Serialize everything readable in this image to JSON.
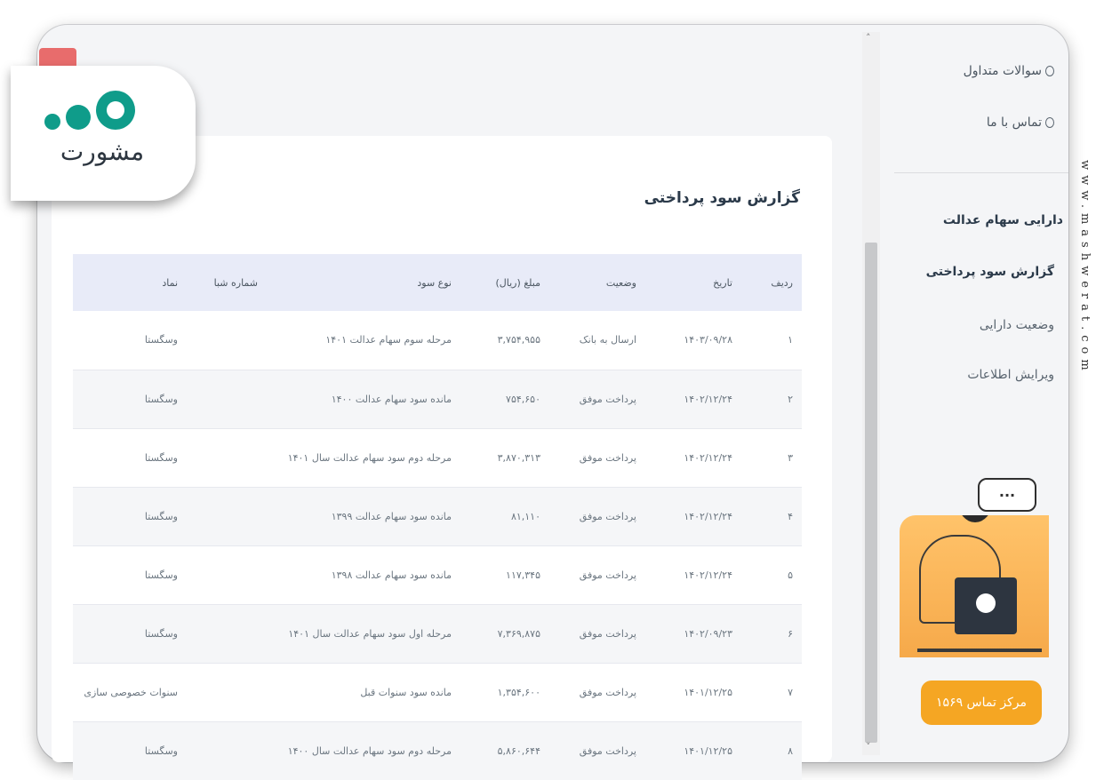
{
  "logo": {
    "word": "مشورت"
  },
  "sidebar": {
    "links": [
      {
        "label": "سوالات متداول",
        "icon": "question-icon"
      },
      {
        "label": "تماس با ما",
        "icon": "phone-icon"
      }
    ],
    "section_title": "دارایی سهام عدالت",
    "items": [
      {
        "label": "گزارش سود پرداختی",
        "active": true
      },
      {
        "label": "وضعیت دارایی",
        "active": false
      },
      {
        "label": "ویرایش اطلاعات",
        "active": false
      }
    ],
    "bubble": "...",
    "call_center": "مرکز تماس ۱۵۶۹"
  },
  "report": {
    "title": "گزارش سود پرداختی",
    "columns": [
      "ردیف",
      "تاریخ",
      "وضعیت",
      "مبلغ (ریال)",
      "نوع سود",
      "شماره شبا",
      "نماد"
    ],
    "rows": [
      [
        "۱",
        "۱۴۰۳/۰۹/۲۸",
        "ارسال به بانک",
        "۳,۷۵۴,۹۵۵",
        "مرحله سوم سهام عدالت ۱۴۰۱",
        "",
        "وسگستا"
      ],
      [
        "۲",
        "۱۴۰۲/۱۲/۲۴",
        "پرداخت موفق",
        "۷۵۴,۶۵۰",
        "مانده سود سهام عدالت ۱۴۰۰",
        "",
        "وسگستا"
      ],
      [
        "۳",
        "۱۴۰۲/۱۲/۲۴",
        "پرداخت موفق",
        "۳,۸۷۰,۳۱۳",
        "مرحله دوم سود سهام عدالت سال ۱۴۰۱",
        "",
        "وسگستا"
      ],
      [
        "۴",
        "۱۴۰۲/۱۲/۲۴",
        "پرداخت موفق",
        "۸۱,۱۱۰",
        "مانده سود سهام عدالت ۱۳۹۹",
        "",
        "وسگستا"
      ],
      [
        "۵",
        "۱۴۰۲/۱۲/۲۴",
        "پرداخت موفق",
        "۱۱۷,۳۴۵",
        "مانده سود سهام عدالت ۱۳۹۸",
        "",
        "وسگستا"
      ],
      [
        "۶",
        "۱۴۰۲/۰۹/۲۳",
        "پرداخت موفق",
        "۷,۳۶۹,۸۷۵",
        "مرحله اول سود سهام عدالت سال ۱۴۰۱",
        "",
        "وسگستا"
      ],
      [
        "۷",
        "۱۴۰۱/۱۲/۲۵",
        "پرداخت موفق",
        "۱,۳۵۴,۶۰۰",
        "مانده سود سنوات قبل",
        "",
        "سنوات خصوصی سازی"
      ],
      [
        "۸",
        "۱۴۰۱/۱۲/۲۵",
        "پرداخت موفق",
        "۵,۸۶۰,۶۴۴",
        "مرحله دوم سود سهام عدالت سال ۱۴۰۰",
        "",
        "وسگستا"
      ]
    ]
  },
  "scrollbar": {
    "up": "˄",
    "down": "˅"
  },
  "watermark": "www.mashwerat.com",
  "colors": {
    "accent": "#0f9c8a",
    "call": "#f5a623",
    "header_bg": "#e8ebf8"
  }
}
